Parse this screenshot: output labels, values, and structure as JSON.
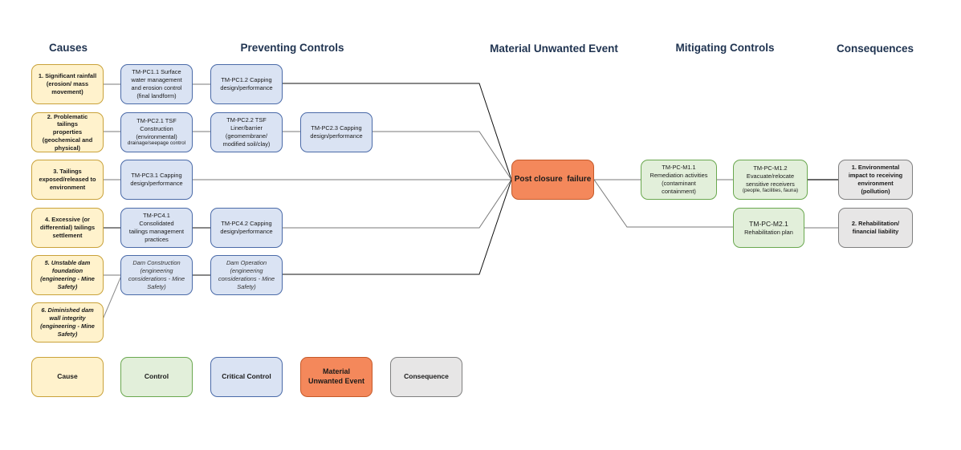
{
  "headers": {
    "causes": "Causes",
    "preventing": "Preventing Controls",
    "mue": "Material Unwanted Event",
    "mitigating": "Mitigating Controls",
    "consequences": "Consequences"
  },
  "causes": [
    {
      "id": "1",
      "lines": [
        "1. Significant rainfall",
        "(erosion/ mass",
        "movement)"
      ]
    },
    {
      "id": "2",
      "lines": [
        "2. Problematic tailings",
        "properties",
        "(geochemical and",
        "physical)"
      ]
    },
    {
      "id": "3",
      "lines": [
        "3. Tailings",
        "exposed/released to",
        "environment"
      ]
    },
    {
      "id": "4",
      "lines": [
        "4. Excessive (or",
        "differential) tailings",
        "settlement"
      ]
    },
    {
      "id": "5",
      "lines": [
        "5. Unstable dam",
        "foundation",
        "(engineering - Mine",
        "Safety)"
      ]
    },
    {
      "id": "6",
      "lines": [
        "6. Diminished dam",
        "wall integrity",
        "(engineering - Mine",
        "Safety)"
      ]
    }
  ],
  "preventing_controls": {
    "pc1_1": {
      "lines": [
        "TM-PC1.1 Surface",
        "water management",
        "and erosion control",
        "(final landform)"
      ]
    },
    "pc1_2": {
      "lines": [
        "TM-PC1.2 Capping",
        "design/performance"
      ]
    },
    "pc2_1": {
      "lines": [
        "TM-PC2.1 TSF",
        "Construction",
        "(environmental)"
      ],
      "note": "drainage/seepage control"
    },
    "pc2_2": {
      "lines": [
        "TM-PC2.2 TSF",
        "Liner/barrier",
        "(geomembrane/",
        "modified soil/clay)"
      ]
    },
    "pc2_3": {
      "lines": [
        "TM-PC2.3 Capping",
        "design/performance"
      ]
    },
    "pc3_1": {
      "lines": [
        "TM-PC3.1 Capping",
        "design/performance"
      ]
    },
    "pc4_1": {
      "lines": [
        "TM-PC4.1 Consolidated",
        "tailings management",
        "practices"
      ]
    },
    "pc4_2": {
      "lines": [
        "TM-PC4.2 Capping",
        "design/performance"
      ]
    },
    "dam_construction": {
      "lines": [
        "Dam Construction",
        "(engineering",
        "considerations - Mine",
        "Safety)"
      ]
    },
    "dam_operation": {
      "lines": [
        "Dam Operation",
        "(engineering",
        "considerations - Mine",
        "Safety)"
      ]
    }
  },
  "mue": {
    "label": "Post closure  failure"
  },
  "mitigating_controls": {
    "m1_1": {
      "lines": [
        "TM-PC-M1.1",
        "Remediation activities",
        "(contaminant",
        "containment)"
      ]
    },
    "m1_2": {
      "lines": [
        "TM-PC-M1.2",
        "Evacuate/relocate",
        "sensitive receivers"
      ],
      "note": "(people, facilities,  fauna)"
    },
    "m2_1": {
      "title": "TM-PC-M2.1",
      "subtitle": "Rehabilitation plan"
    }
  },
  "consequences": [
    {
      "id": "1",
      "lines": [
        "1. Environmental",
        "impact to receiving",
        "environment (pollution)"
      ]
    },
    {
      "id": "2",
      "lines": [
        "2. Rehabilitation/",
        "financial liability"
      ]
    }
  ],
  "legend": {
    "cause": "Cause",
    "control": "Control",
    "critical_control": "Critical Control",
    "mue_line1": "Material",
    "mue_line2": "Unwanted Event",
    "consequence": "Consequence"
  },
  "colors": {
    "cause_fill": "#fff2cc",
    "control_fill": "#e2efda",
    "critical_control_fill": "#dae3f3",
    "mue_fill": "#f4885b",
    "consequence_fill": "#e7e6e6",
    "header_text": "#1f3350"
  }
}
